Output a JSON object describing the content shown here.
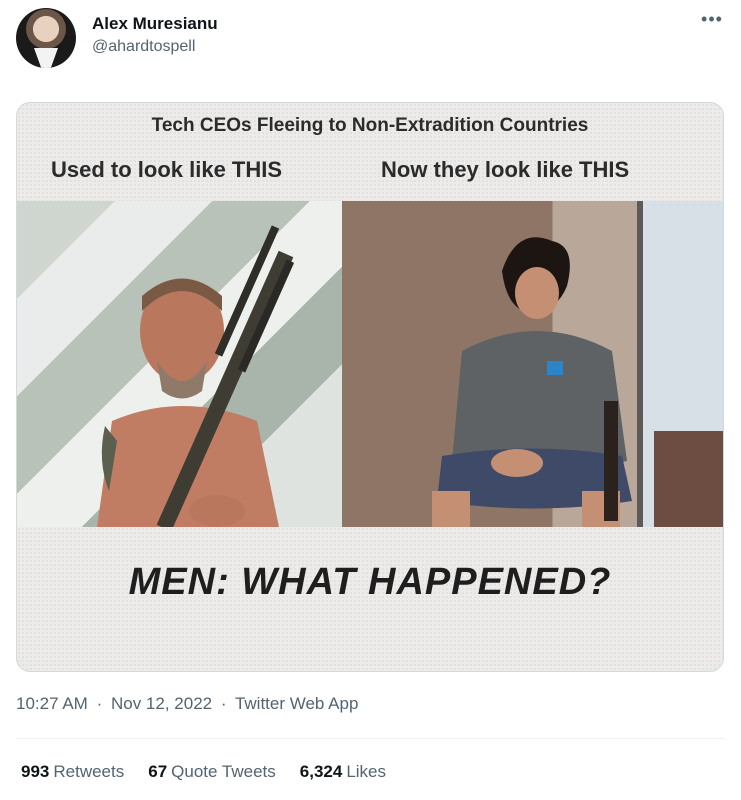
{
  "author": {
    "name": "Alex Muresianu",
    "handle": "@ahardtospell"
  },
  "more_icon": "more-horizontal-icon",
  "meme": {
    "title": "Tech CEOs Fleeing to Non-Extradition Countries",
    "caption_left": "Used to look like THIS",
    "caption_right": "Now they look like THIS",
    "bottom_text": "MEN: WHAT HAPPENED?"
  },
  "meta": {
    "time": "10:27 AM",
    "date": "Nov 12, 2022",
    "source": "Twitter Web App",
    "separator": "·"
  },
  "stats": {
    "retweets_count": "993",
    "retweets_label": "Retweets",
    "quotes_count": "67",
    "quotes_label": "Quote Tweets",
    "likes_count": "6,324",
    "likes_label": "Likes"
  },
  "colors": {
    "text_primary": "#0f1419",
    "text_secondary": "#536471",
    "border": "#cfd9de"
  }
}
